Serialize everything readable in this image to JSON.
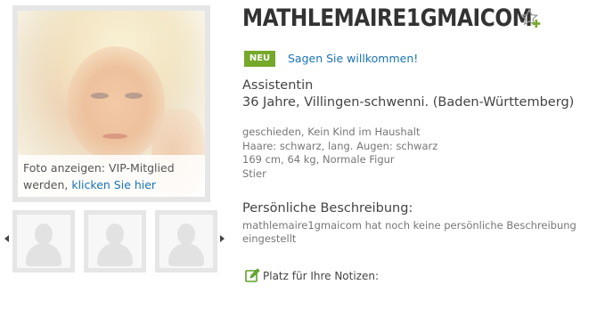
{
  "photo": {
    "caption_text": "Foto anzeigen: VIP-Mitglied werden,",
    "caption_link": "klicken Sie hier"
  },
  "thumbnails": [
    {
      "icon": "user-placeholder-icon"
    },
    {
      "icon": "user-placeholder-icon"
    },
    {
      "icon": "user-placeholder-icon"
    }
  ],
  "profile": {
    "username": "MATHLEMAIRE1GMAICOM",
    "badge": "NEU",
    "welcome_link": "Sagen Sie willkommen!",
    "occupation": "Assistentin",
    "age_location": "36 Jahre, Villingen-schwenni. (Baden-Württemberg)",
    "details": [
      "geschieden, Kein Kind im Haushalt",
      "Haare: schwarz, lang. Augen: schwarz",
      "169 cm, 64 kg, Normale Figur",
      "Stier"
    ]
  },
  "description": {
    "heading": "Persönliche Beschreibung:",
    "text": "mathlemaire1gmaicom hat noch keine persönliche Beschreibung eingestellt"
  },
  "notes": {
    "label": "Platz für Ihre Notizen:"
  },
  "colors": {
    "badge": "#76a82a",
    "link": "#1a73b5",
    "title": "#333333",
    "frame": "#e6e6e6"
  }
}
